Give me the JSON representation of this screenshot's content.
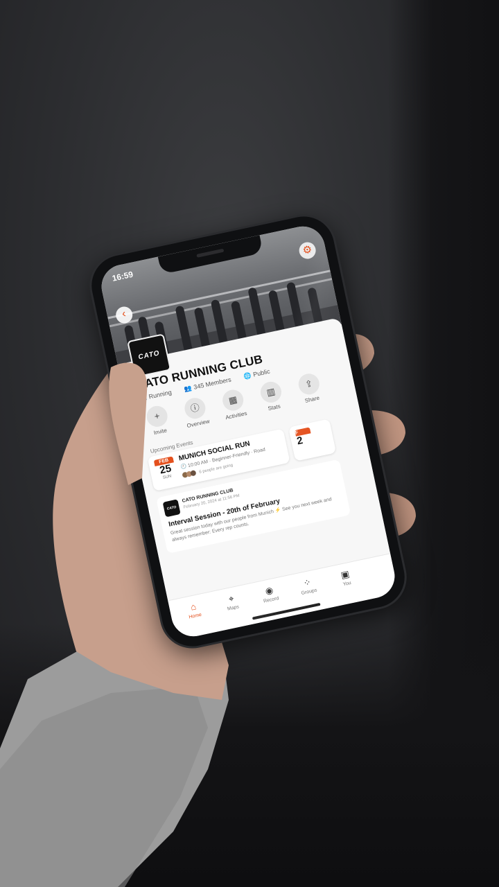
{
  "status_bar": {
    "time": "16:59"
  },
  "club": {
    "logo_text": "CATO",
    "name": "CATO RUNNING CLUB",
    "sport": "Running",
    "members": "345 Members",
    "visibility": "Public"
  },
  "actions": [
    {
      "label": "Invite",
      "icon": "add-person-icon"
    },
    {
      "label": "Overview",
      "icon": "info-icon"
    },
    {
      "label": "Activities",
      "icon": "image-icon"
    },
    {
      "label": "Stats",
      "icon": "bar-chart-icon"
    },
    {
      "label": "Share",
      "icon": "share-icon"
    }
  ],
  "upcoming": {
    "heading": "Upcoming Events",
    "event": {
      "month": "FEB",
      "day": "25",
      "dow": "SUN",
      "title": "MUNICH SOCIAL RUN",
      "meta": "10:00 AM · Beginner-Friendly · Road",
      "going": "6 people are going"
    },
    "next_month": "F",
    "next_day": "2"
  },
  "post": {
    "author_logo": "CATO",
    "author": "CATO RUNNING CLUB",
    "date": "February 20, 2024 at 11:56 PM",
    "title": "Interval Session - 20th of February",
    "body": "Great session today with our people from Munich ⚡ See you next week and always remember: Every rep counts."
  },
  "tabs": [
    {
      "label": "Home",
      "icon": "home-icon",
      "active": true
    },
    {
      "label": "Maps",
      "icon": "map-icon",
      "active": false
    },
    {
      "label": "Record",
      "icon": "record-icon",
      "active": false
    },
    {
      "label": "Groups",
      "icon": "groups-icon",
      "active": false
    },
    {
      "label": "You",
      "icon": "profile-icon",
      "active": false
    }
  ],
  "colors": {
    "accent": "#e4501d",
    "background": "#f7f7f7"
  }
}
